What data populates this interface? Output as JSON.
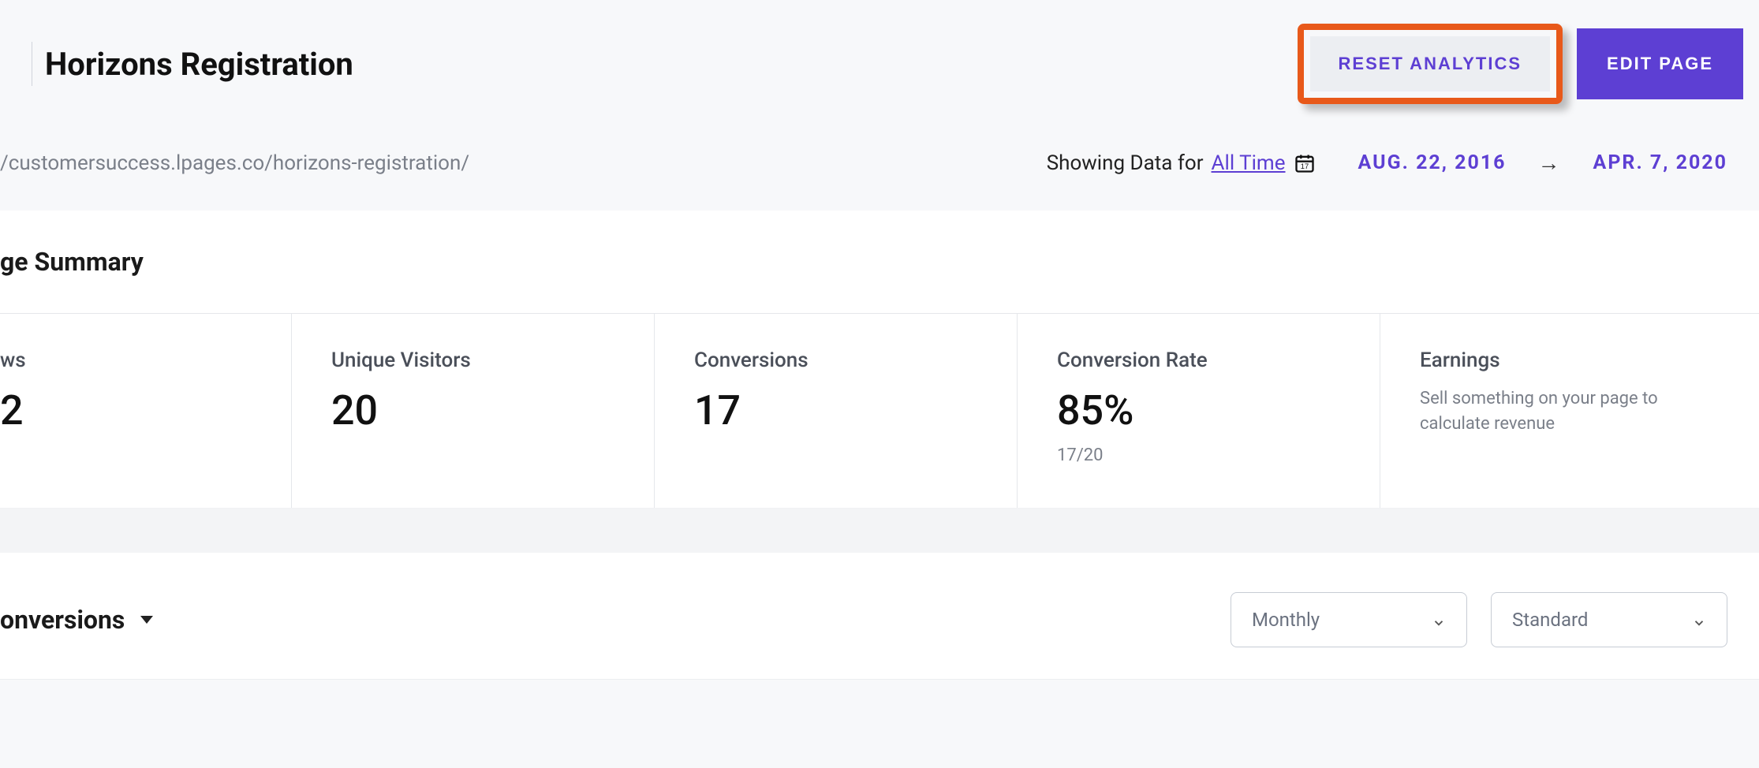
{
  "header": {
    "title": "Horizons Registration",
    "reset_label": "RESET ANALYTICS",
    "edit_label": "EDIT PAGE"
  },
  "subheader": {
    "url": "/customersuccess.lpages.co/horizons-registration/",
    "showing_prefix": "Showing Data for ",
    "showing_range_label": "All Time",
    "date_start": "AUG. 22, 2016",
    "date_arrow": "→",
    "date_end": "APR. 7, 2020"
  },
  "summary": {
    "heading": "ge Summary",
    "metrics": [
      {
        "label": "ws",
        "value": "2"
      },
      {
        "label": "Unique Visitors",
        "value": "20"
      },
      {
        "label": "Conversions",
        "value": "17"
      },
      {
        "label": "Conversion Rate",
        "value": "85%",
        "sub": "17/20"
      },
      {
        "label": "Earnings",
        "desc": "Sell something on your page to calculate revenue"
      }
    ]
  },
  "chart_controls": {
    "title": "onversions",
    "interval_selected": "Monthly",
    "mode_selected": "Standard"
  }
}
